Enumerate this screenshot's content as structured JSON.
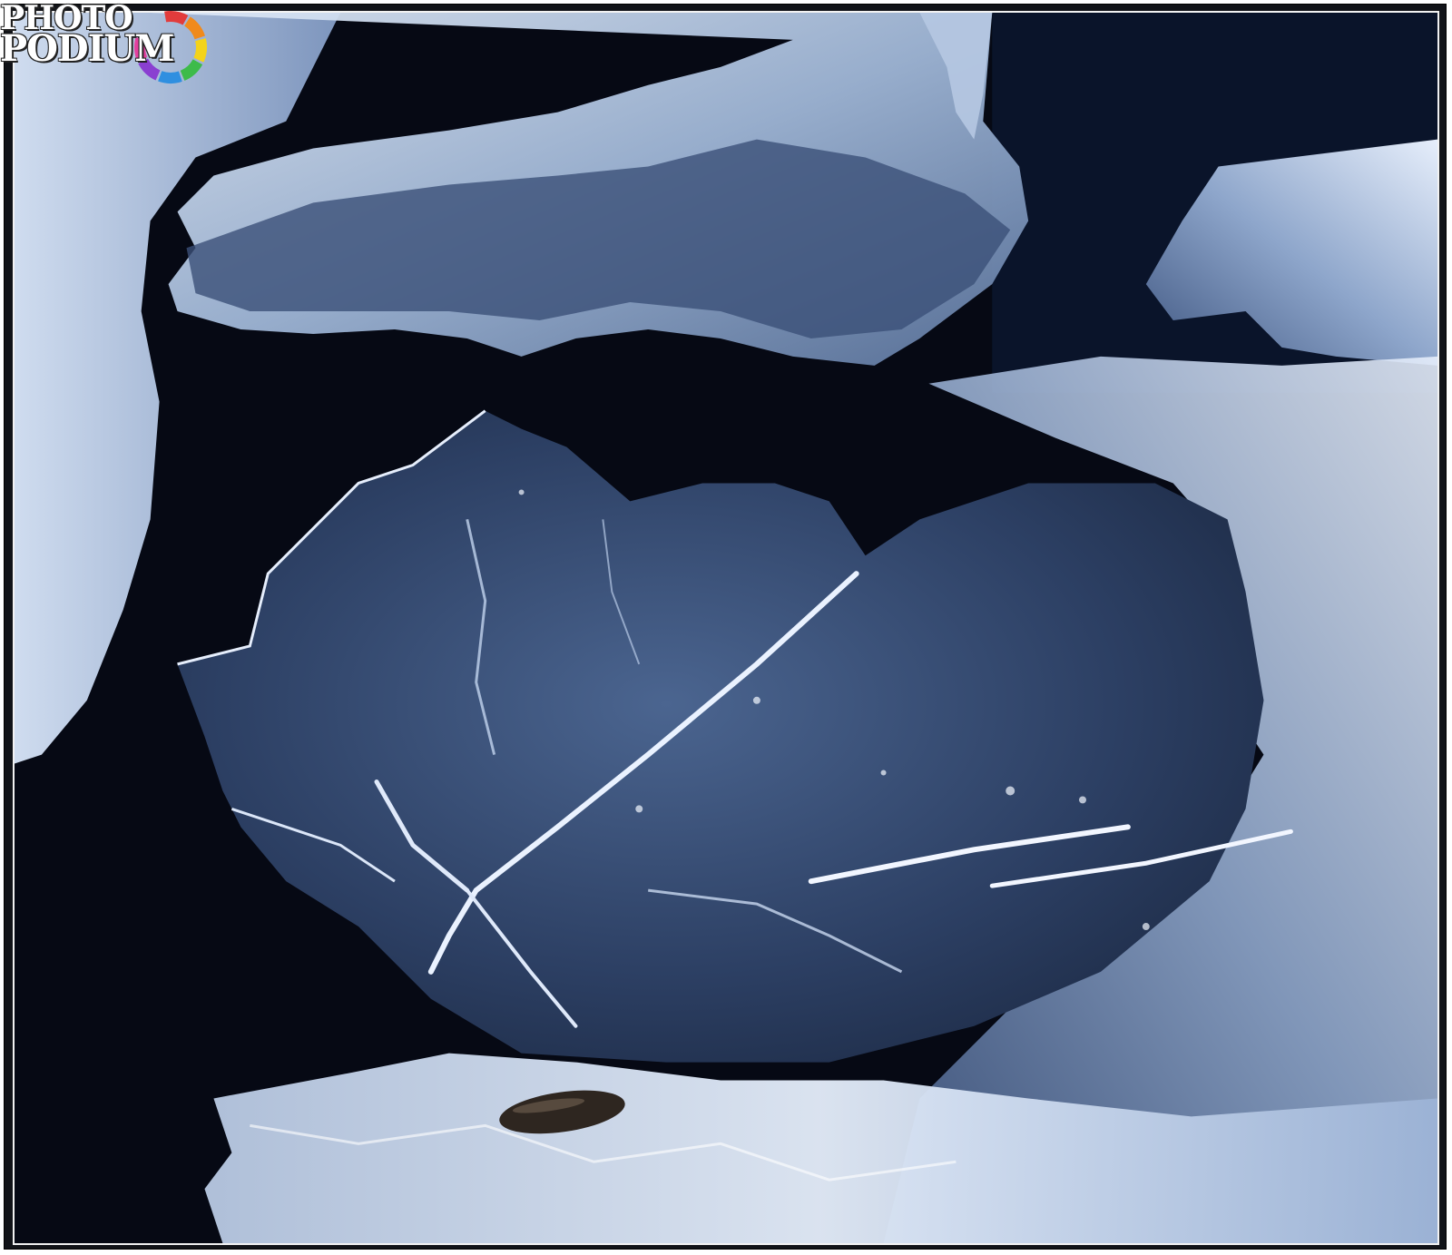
{
  "logo": {
    "line1": "PHOTO",
    "line2": "PODIUM",
    "ring_colors": [
      "#e23b3b",
      "#f08a1c",
      "#f4d31a",
      "#3dbb4a",
      "#2f8fe0",
      "#8a3fd1",
      "#e43f9e"
    ]
  },
  "photo": {
    "subject": "ice-crystal-formations",
    "colors": {
      "background": "#05070d",
      "ice_dark": "#2a3c5c",
      "ice_mid": "#5a75a0",
      "ice_light": "#c8d8ee",
      "frost_white": "#eef4ff"
    }
  }
}
